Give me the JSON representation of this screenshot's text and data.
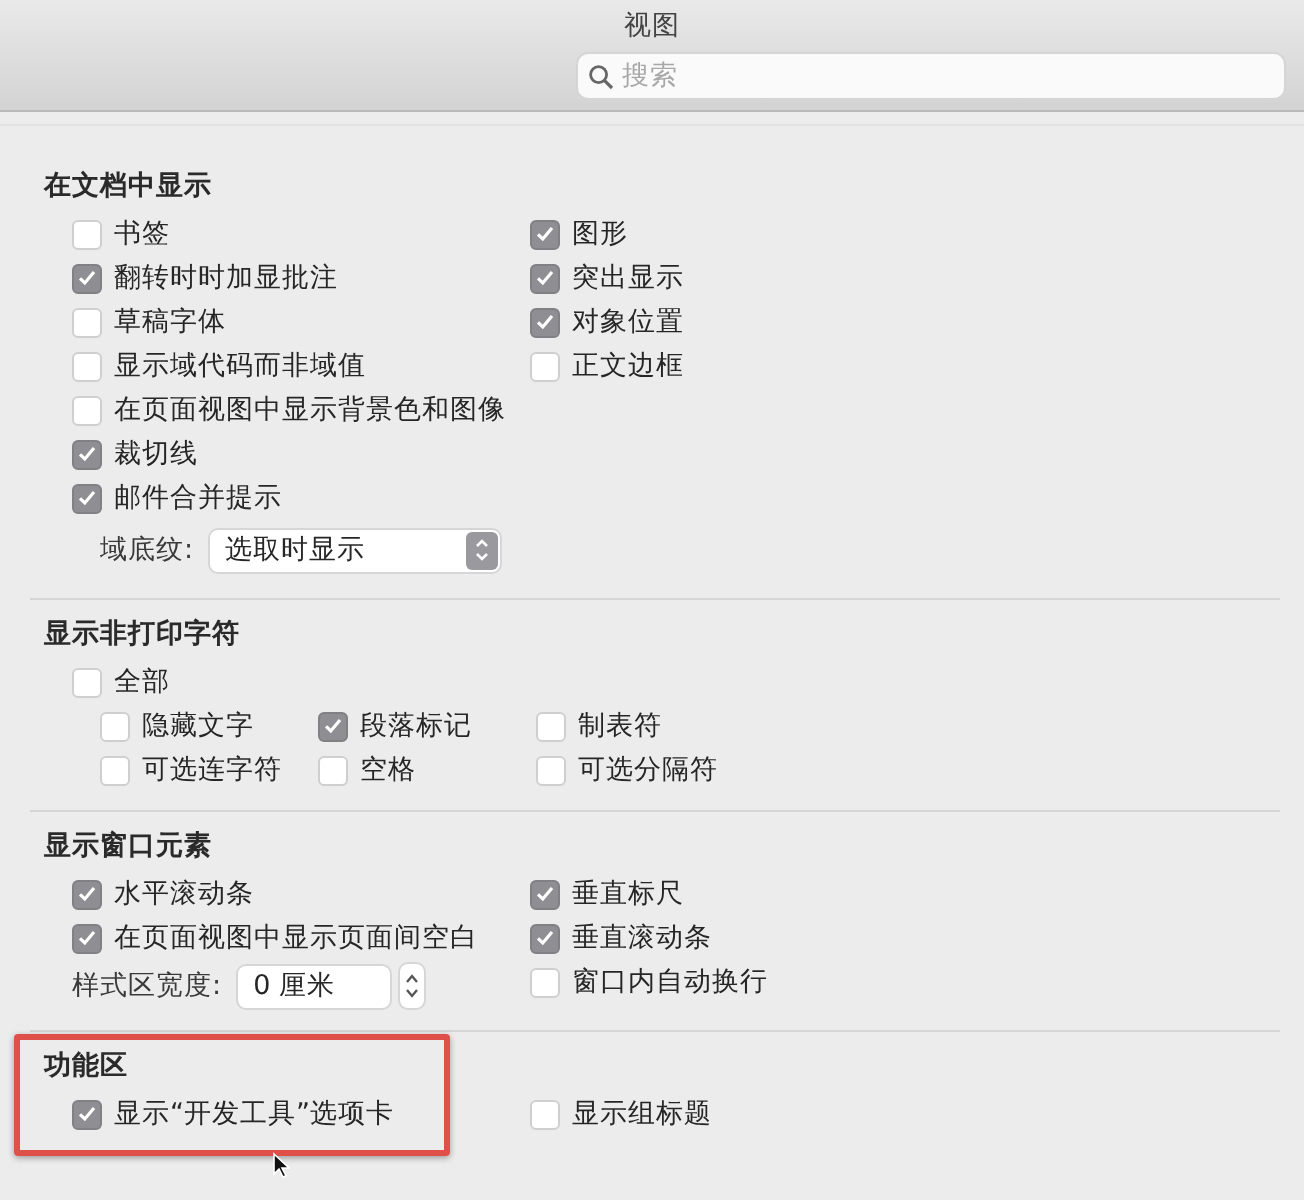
{
  "window": {
    "title": "视图"
  },
  "search": {
    "placeholder": "搜索"
  },
  "sections": [
    {
      "title": "在文档中显示",
      "highlighted": false,
      "rows": [
        {
          "kind": "columns",
          "columns": [
            [
              {
                "kind": "checkbox",
                "label": "书签",
                "checked": false
              },
              {
                "kind": "checkbox",
                "label": "翻转时时加显批注",
                "checked": true
              },
              {
                "kind": "checkbox",
                "label": "草稿字体",
                "checked": false
              },
              {
                "kind": "checkbox",
                "label": "显示域代码而非域值",
                "checked": false
              },
              {
                "kind": "checkbox",
                "label": "在页面视图中显示背景色和图像",
                "checked": false
              },
              {
                "kind": "checkbox",
                "label": "裁切线",
                "checked": true
              },
              {
                "kind": "checkbox",
                "label": "邮件合并提示",
                "checked": true
              },
              {
                "kind": "popup",
                "label": "域底纹:",
                "value": "选取时显示"
              }
            ],
            [
              {
                "kind": "checkbox",
                "label": "图形",
                "checked": true
              },
              {
                "kind": "checkbox",
                "label": "突出显示",
                "checked": true
              },
              {
                "kind": "checkbox",
                "label": "对象位置",
                "checked": true
              },
              {
                "kind": "checkbox",
                "label": "正文边框",
                "checked": false
              }
            ]
          ]
        }
      ]
    },
    {
      "title": "显示非打印字符",
      "highlighted": false,
      "rows": [
        {
          "kind": "checkbox",
          "label": "全部",
          "checked": false
        },
        {
          "kind": "subcolumns",
          "columns": [
            [
              {
                "kind": "checkbox",
                "label": "隐藏文字",
                "checked": false
              },
              {
                "kind": "checkbox",
                "label": "可选连字符",
                "checked": false
              }
            ],
            [
              {
                "kind": "checkbox",
                "label": "段落标记",
                "checked": true
              },
              {
                "kind": "checkbox",
                "label": "空格",
                "checked": false
              }
            ],
            [
              {
                "kind": "checkbox",
                "label": "制表符",
                "checked": false
              },
              {
                "kind": "checkbox",
                "label": "可选分隔符",
                "checked": false
              }
            ]
          ]
        }
      ]
    },
    {
      "title": "显示窗口元素",
      "highlighted": false,
      "rows": [
        {
          "kind": "columns",
          "columns": [
            [
              {
                "kind": "checkbox",
                "label": "水平滚动条",
                "checked": true
              },
              {
                "kind": "checkbox",
                "label": "在页面视图中显示页面间空白",
                "checked": true
              },
              {
                "kind": "stepper",
                "label": "样式区宽度:",
                "value": "0 厘米"
              }
            ],
            [
              {
                "kind": "checkbox",
                "label": "垂直标尺",
                "checked": true
              },
              {
                "kind": "checkbox",
                "label": "垂直滚动条",
                "checked": true
              },
              {
                "kind": "checkbox",
                "label": "窗口内自动换行",
                "checked": false
              }
            ]
          ]
        }
      ]
    },
    {
      "title": "功能区",
      "highlighted": true,
      "rows": [
        {
          "kind": "columns",
          "columns": [
            [
              {
                "kind": "checkbox",
                "label": "显示“开发工具”选项卡",
                "checked": true
              }
            ],
            [
              {
                "kind": "checkbox",
                "label": "显示组标题",
                "checked": false
              }
            ]
          ]
        }
      ]
    }
  ]
}
